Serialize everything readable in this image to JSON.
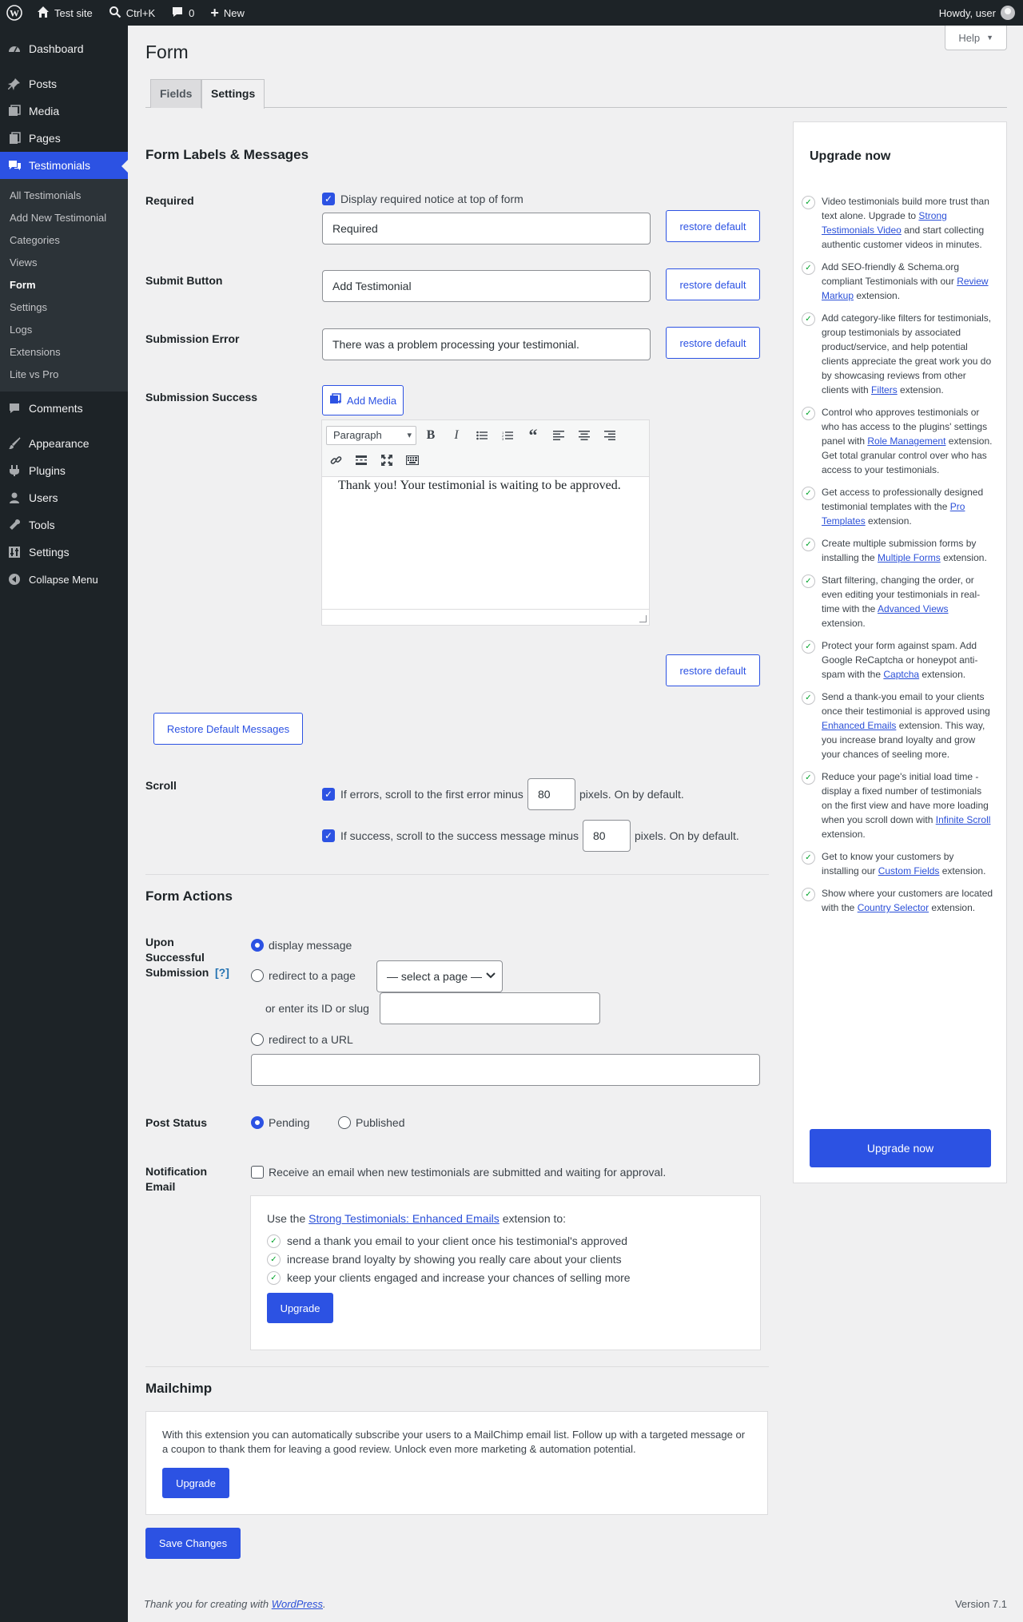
{
  "adminbar": {
    "site_name": "Test site",
    "search_shortcut": "Ctrl+K",
    "comments_count": "0",
    "new_label": "New",
    "howdy": "Howdy, user"
  },
  "sidebar": {
    "items": [
      {
        "label": "Dashboard",
        "icon": "dashboard-icon"
      },
      {
        "label": "Posts",
        "icon": "pin-icon"
      },
      {
        "label": "Media",
        "icon": "media-icon"
      },
      {
        "label": "Pages",
        "icon": "pages-icon"
      },
      {
        "label": "Testimonials",
        "icon": "testimonials-icon"
      },
      {
        "label": "Comments",
        "icon": "comments-icon"
      },
      {
        "label": "Appearance",
        "icon": "brush-icon"
      },
      {
        "label": "Plugins",
        "icon": "plugin-icon"
      },
      {
        "label": "Users",
        "icon": "users-icon"
      },
      {
        "label": "Tools",
        "icon": "wrench-icon"
      },
      {
        "label": "Settings",
        "icon": "settings-icon"
      },
      {
        "label": "Collapse Menu",
        "icon": "collapse-icon"
      }
    ],
    "submenu": [
      "All Testimonials",
      "Add New Testimonial",
      "Categories",
      "Views",
      "Form",
      "Settings",
      "Logs",
      "Extensions",
      "Lite vs Pro"
    ]
  },
  "page": {
    "title": "Form",
    "help": "Help",
    "tabs": [
      "Fields",
      "Settings"
    ]
  },
  "labels_section": {
    "heading": "Form Labels & Messages",
    "required_label": "Required",
    "required_checkbox": "Display required notice at top of form",
    "required_value": "Required",
    "submit_label": "Submit Button",
    "submit_value": "Add Testimonial",
    "error_label": "Submission Error",
    "error_value": "There was a problem processing your testimonial.",
    "success_label": "Submission Success",
    "add_media": "Add Media",
    "format_select": "Paragraph",
    "success_text": "Thank you! Your testimonial is waiting to be approved.",
    "restore_default": "restore default",
    "restore_all": "Restore Default Messages"
  },
  "scroll": {
    "label": "Scroll",
    "error_text_before": "If errors, scroll to the first error minus",
    "error_value": "80",
    "error_text_after": "pixels. On by default.",
    "success_text_before": "If success, scroll to the success message minus",
    "success_value": "80",
    "success_text_after": "pixels. On by default."
  },
  "form_actions": {
    "heading": "Form Actions",
    "upon_label": "Upon Successful Submission",
    "help_link": "[?]",
    "opt_display": "display message",
    "opt_redirect_page": "redirect to a page",
    "select_page": "— select a page —",
    "or_enter": "or enter its ID or slug",
    "opt_redirect_url": "redirect to a URL",
    "post_status_label": "Post Status",
    "status_pending": "Pending",
    "status_published": "Published",
    "notification_label": "Notification Email",
    "notification_checkbox": "Receive an email when new testimonials are submitted and waiting for approval.",
    "promo_intro_before": "Use the",
    "promo_link": "Strong Testimonials: Enhanced Emails",
    "promo_intro_after": "extension to:",
    "promo_items": [
      "send a thank you email to your client once his testimonial's approved",
      "increase brand loyalty by showing you really care about your clients",
      "keep your clients engaged and increase your chances of selling more"
    ],
    "upgrade": "Upgrade"
  },
  "mailchimp": {
    "heading": "Mailchimp",
    "text": "With this extension you can automatically subscribe your users to a MailChimp email list. Follow up with a targeted message or a coupon to thank them for leaving a good review. Unlock even more marketing & automation potential.",
    "upgrade": "Upgrade"
  },
  "save": "Save Changes",
  "upgrade_panel": {
    "heading": "Upgrade now",
    "items": [
      {
        "before": "Video testimonials build more trust than text alone. Upgrade to ",
        "link": "Strong Testimonials Video",
        "after": " and start collecting authentic customer videos in minutes."
      },
      {
        "before": "Add SEO-friendly & Schema.org compliant Testimonials with our ",
        "link": "Review Markup",
        "after": " extension."
      },
      {
        "before": "Add category-like filters for testimonials, group testimonials by associated product/service, and help potential clients appreciate the great work you do by showcasing reviews from other clients with ",
        "link": "Filters",
        "after": " extension."
      },
      {
        "before": "Control who approves testimonials or who has access to the plugins' settings panel with ",
        "link": "Role Management",
        "after": " extension. Get total granular control over who has access to your testimonials."
      },
      {
        "before": "Get access to professionally designed testimonial templates with the ",
        "link": "Pro Templates",
        "after": " extension."
      },
      {
        "before": "Create multiple submission forms by installing the ",
        "link": "Multiple Forms",
        "after": " extension."
      },
      {
        "before": "Start filtering, changing the order, or even editing your testimonials in real-time with the ",
        "link": "Advanced Views",
        "after": " extension."
      },
      {
        "before": "Protect your form against spam. Add Google ReCaptcha or honeypot anti-spam with the ",
        "link": "Captcha",
        "after": " extension."
      },
      {
        "before": "Send a thank-you email to your clients once their testimonial is approved using ",
        "link": "Enhanced Emails",
        "after": " extension. This way, you increase brand loyalty and grow your chances of seeling more."
      },
      {
        "before": "Reduce your page's initial load time - display a fixed number of testimonials on the first view and have more loading when you scroll down with ",
        "link": "Infinite Scroll",
        "after": " extension."
      },
      {
        "before": "Get to know your customers by installing our ",
        "link": "Custom Fields",
        "after": " extension."
      },
      {
        "before": "Show where your customers are located with the ",
        "link": "Country Selector",
        "after": " extension."
      }
    ],
    "button": "Upgrade now"
  },
  "footer": {
    "thanks_before": "Thank you for creating with",
    "thanks_link": "WordPress",
    "thanks_after": ".",
    "version": "Version 7.1"
  },
  "colors": {
    "accent": "#2c52e3",
    "sidebar_bg": "#1d2327",
    "background": "#f0f0f1"
  }
}
